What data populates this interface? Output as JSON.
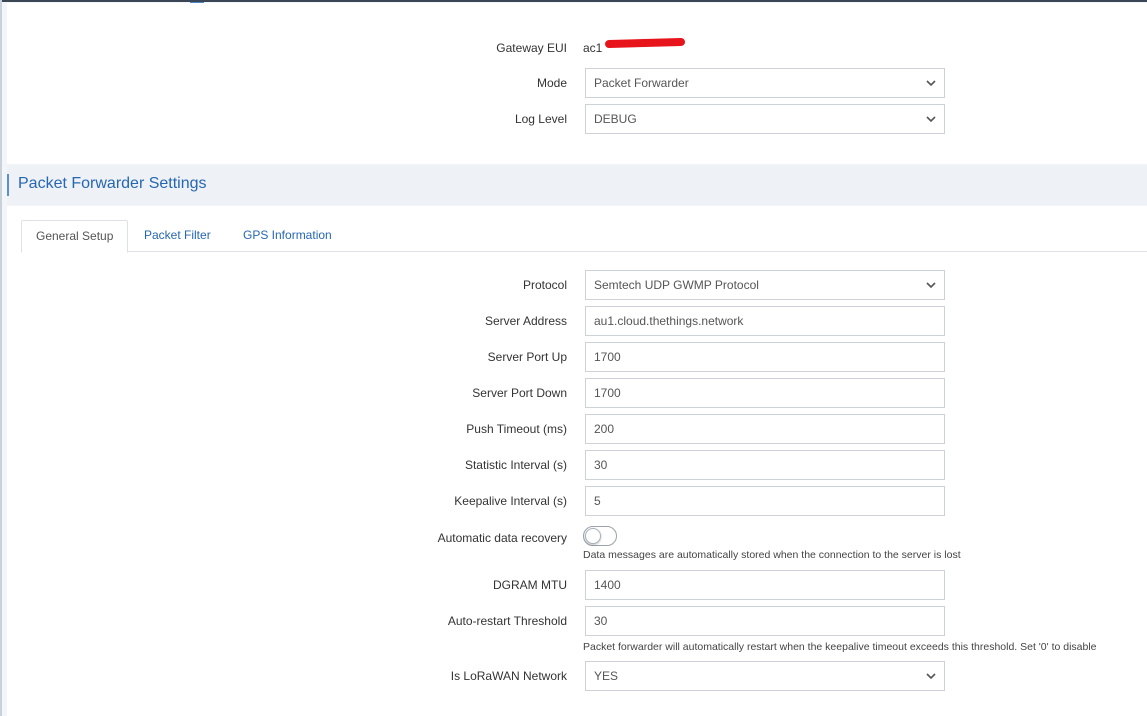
{
  "gateway": {
    "eui_label": "Gateway EUI",
    "eui_value": "ac1",
    "mode_label": "Mode",
    "mode_value": "Packet Forwarder",
    "log_level_label": "Log Level",
    "log_level_value": "DEBUG"
  },
  "section": {
    "title": "Packet Forwarder Settings"
  },
  "tabs": [
    {
      "label": "General Setup",
      "active": true
    },
    {
      "label": "Packet Filter",
      "active": false
    },
    {
      "label": "GPS Information",
      "active": false
    }
  ],
  "form": {
    "protocol_label": "Protocol",
    "protocol_value": "Semtech UDP GWMP Protocol",
    "server_address_label": "Server Address",
    "server_address_value": "au1.cloud.thethings.network",
    "server_port_up_label": "Server Port Up",
    "server_port_up_value": "1700",
    "server_port_down_label": "Server Port Down",
    "server_port_down_value": "1700",
    "push_timeout_label": "Push Timeout (ms)",
    "push_timeout_value": "200",
    "statistic_interval_label": "Statistic Interval (s)",
    "statistic_interval_value": "30",
    "keepalive_interval_label": "Keepalive Interval (s)",
    "keepalive_interval_value": "5",
    "auto_recovery_label": "Automatic data recovery",
    "auto_recovery_enabled": false,
    "auto_recovery_help": "Data messages are automatically stored when the connection to the server is lost",
    "dgram_mtu_label": "DGRAM MTU",
    "dgram_mtu_value": "1400",
    "auto_restart_label": "Auto-restart Threshold",
    "auto_restart_value": "30",
    "auto_restart_help": "Packet forwarder will automatically restart when the keepalive timeout exceeds this threshold. Set '0' to disable",
    "is_lorawan_label": "Is LoRaWAN Network",
    "is_lorawan_value": "YES"
  },
  "colors": {
    "accent": "#2667b1",
    "redaction": "#e8141b"
  }
}
